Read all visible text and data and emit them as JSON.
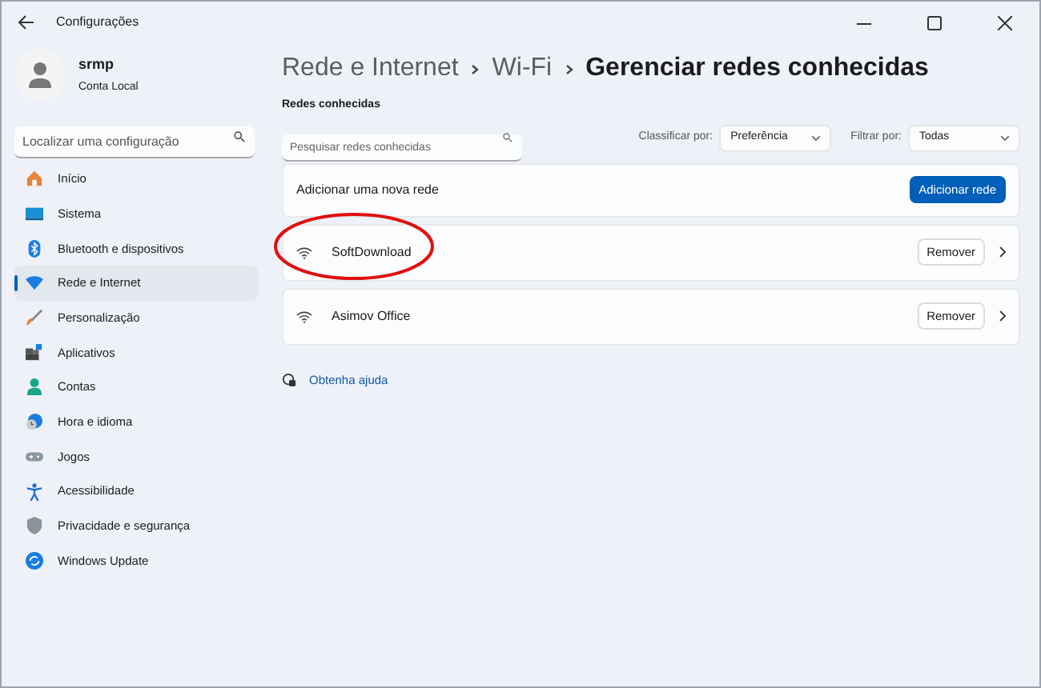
{
  "window": {
    "title": "Configurações"
  },
  "account": {
    "name": "srmp",
    "type": "Conta Local"
  },
  "search": {
    "placeholder": "Localizar uma configuração"
  },
  "sidebar": {
    "items": [
      {
        "label": "Início",
        "selected": false
      },
      {
        "label": "Sistema",
        "selected": false
      },
      {
        "label": "Bluetooth e dispositivos",
        "selected": false
      },
      {
        "label": "Rede e Internet",
        "selected": true
      },
      {
        "label": "Personalização",
        "selected": false
      },
      {
        "label": "Aplicativos",
        "selected": false
      },
      {
        "label": "Contas",
        "selected": false
      },
      {
        "label": "Hora e idioma",
        "selected": false
      },
      {
        "label": "Jogos",
        "selected": false
      },
      {
        "label": "Acessibilidade",
        "selected": false
      },
      {
        "label": "Privacidade e segurança",
        "selected": false
      },
      {
        "label": "Windows Update",
        "selected": false
      }
    ]
  },
  "breadcrumb": [
    "Rede e Internet",
    "Wi-Fi",
    "Gerenciar redes conhecidas"
  ],
  "section_title": "Redes conhecidas",
  "network_search": {
    "placeholder": "Pesquisar redes conhecidas"
  },
  "sort": {
    "label": "Classificar por:",
    "value": "Preferência"
  },
  "filter": {
    "label": "Filtrar por:",
    "value": "Todas"
  },
  "add_network": {
    "label": "Adicionar uma nova rede",
    "button": "Adicionar rede"
  },
  "networks": [
    {
      "name": "SoftDownload",
      "button": "Remover",
      "highlighted": true
    },
    {
      "name": "Asimov Office",
      "button": "Remover",
      "highlighted": false
    }
  ],
  "help_link": "Obtenha ajuda"
}
